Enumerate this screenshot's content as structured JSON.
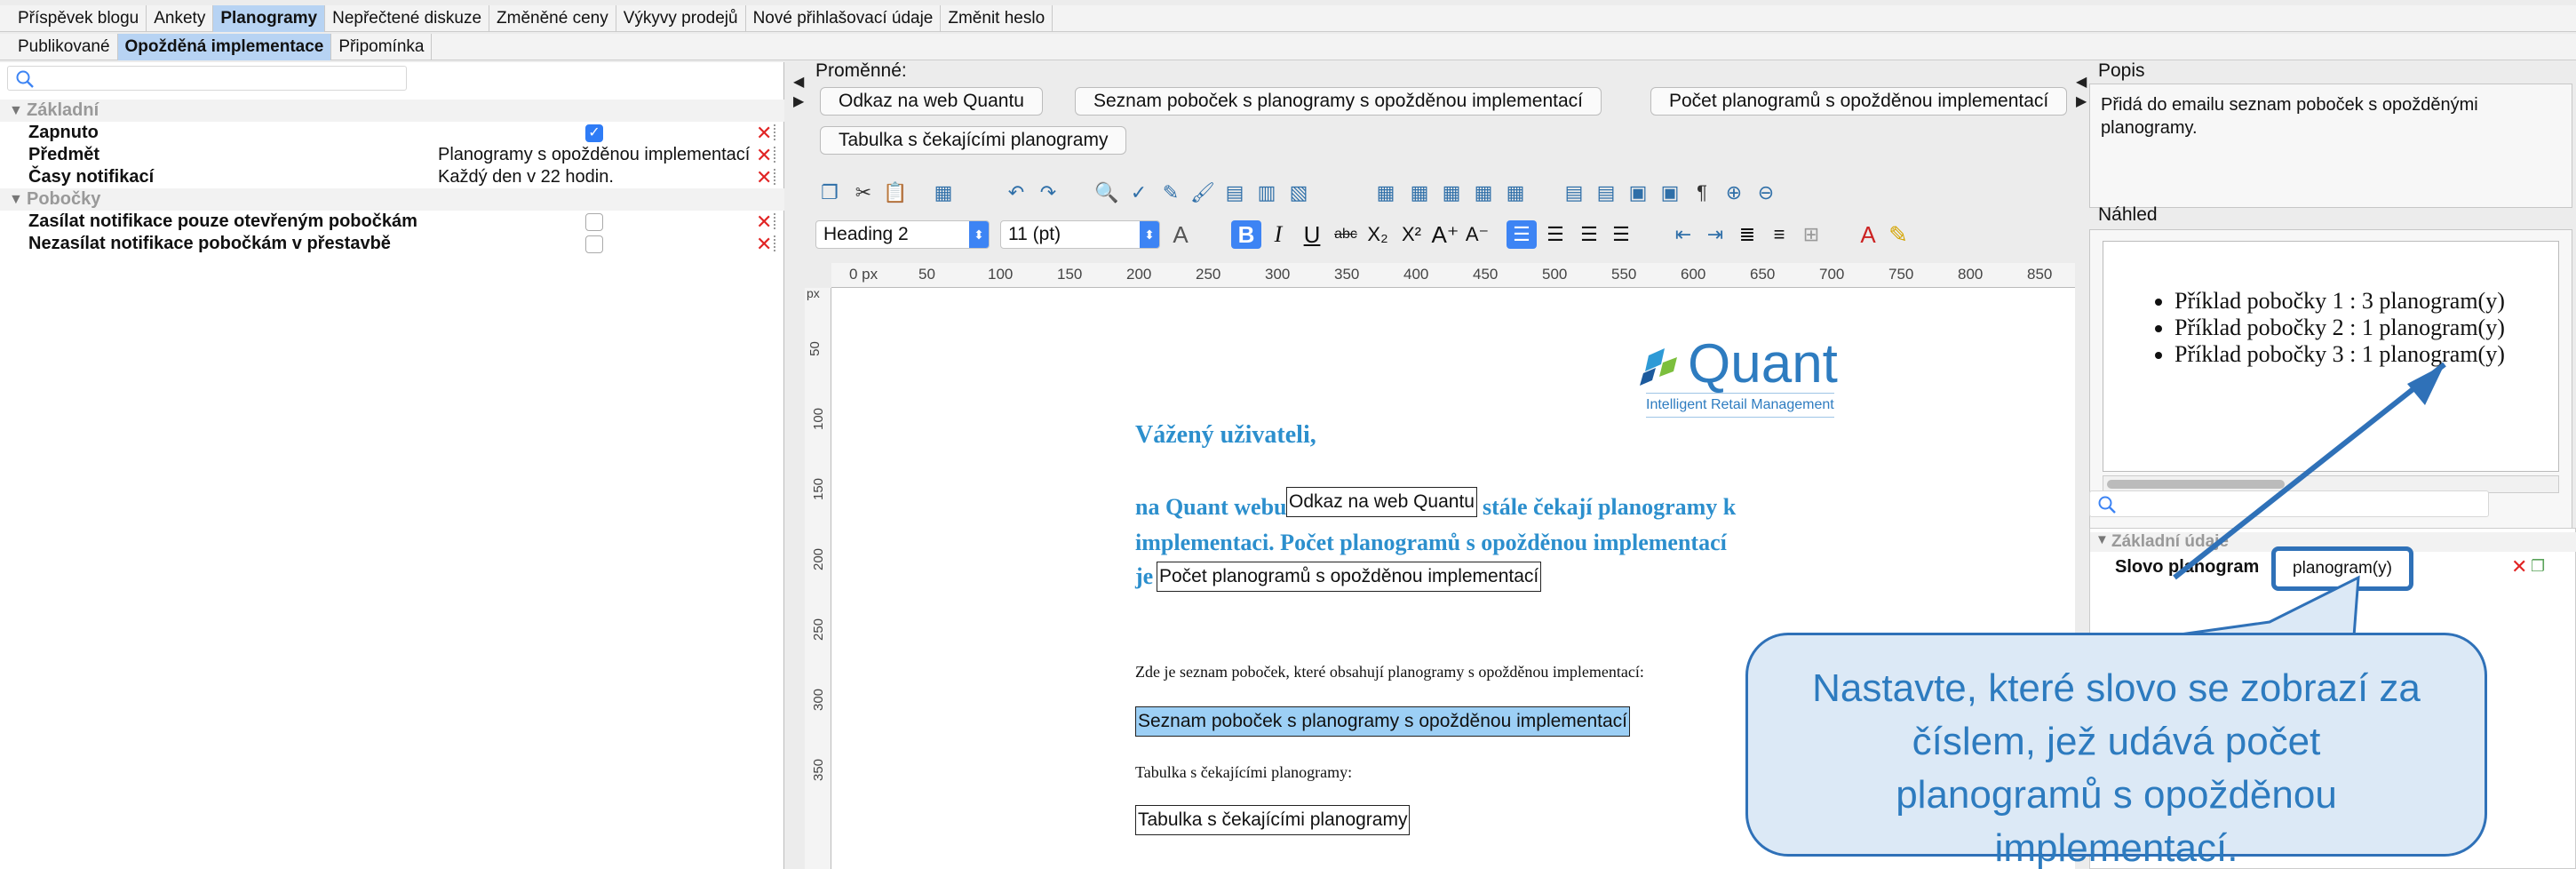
{
  "top_tabs": [
    "Příspěvek blogu",
    "Ankety",
    "Planogramy",
    "Nepřečtené diskuze",
    "Změněné ceny",
    "Výkyvy prodejů",
    "Nové přihlašovací údaje",
    "Změnit heslo"
  ],
  "top_active": "Planogramy",
  "sub_tabs": [
    "Publikované",
    "Opožděná implementace",
    "Připomínka"
  ],
  "sub_active": "Opožděná implementace",
  "props": {
    "section_basic": "Základní",
    "enabled_label": "Zapnuto",
    "subject_label": "Předmět",
    "subject_value": "Planogramy s opožděnou implementací",
    "times_label": "Časy notifikací",
    "times_value": "Každý den v 22 hodin.",
    "section_branches": "Pobočky",
    "open_only_label": "Zasílat notifikace pouze otevřeným pobočkám",
    "no_remodel_label": "Nezasílat notifikace pobočkám v přestavbě",
    "remove_glyph": "✕"
  },
  "variables": {
    "title": "Proměnné:",
    "buttons": [
      "Odkaz na web Quantu",
      "Seznam poboček s planogramy s opožděnou implementací",
      "Počet planogramů s opožděnou implementací",
      "Tabulka s čekajícími planogramy"
    ]
  },
  "toolbar": {
    "style_value": "Heading 2",
    "size_value": "11 (pt)"
  },
  "ruler": {
    "unit": "px",
    "ticks": [
      "0 px",
      "50",
      "100",
      "150",
      "200",
      "250",
      "300",
      "350",
      "400",
      "450",
      "500",
      "550",
      "600",
      "650",
      "700",
      "750",
      "800",
      "850"
    ],
    "vticks": [
      "50",
      "100",
      "150",
      "200",
      "250",
      "300",
      "350"
    ]
  },
  "document": {
    "logo_text": "Quant",
    "logo_tagline": "Intelligent Retail Management",
    "greeting": "Vážený uživateli,",
    "line1_pre": "na Quant webu",
    "line1_var": "Odkaz na web Quantu",
    "line1_post": "stále čekají planogramy k",
    "line2": "implementaci. Počet planogramů s opožděnou implementací",
    "line3_pre": "je",
    "line3_var": "Počet planogramů s opožděnou implementací",
    "intro_list": "Zde je seznam poboček, které obsahují planogramy s opožděnou implementací:",
    "list_var": "Seznam poboček s planogramy s opožděnou implementací",
    "table_label": "Tabulka s čekajícími planogramy:",
    "table_var": "Tabulka s čekajícími planogramy"
  },
  "description": {
    "title": "Popis",
    "text": "Přidá do emailu seznam poboček s opožděnými planogramy."
  },
  "preview": {
    "title": "Náhled",
    "items": [
      "Příklad pobočky 1 : 3 planogram(y)",
      "Příklad pobočky 2 : 1 planogram(y)",
      "Příklad pobočky 3 : 1 planogram(y)"
    ]
  },
  "details": {
    "section": "Základní údaje",
    "word_label": "Slovo planogram",
    "word_value": "planogram(y)"
  },
  "callout": {
    "text": "Nastavte, které slovo se zobrazí za číslem, jež udává počet planogramů s opožděnou implementací."
  }
}
